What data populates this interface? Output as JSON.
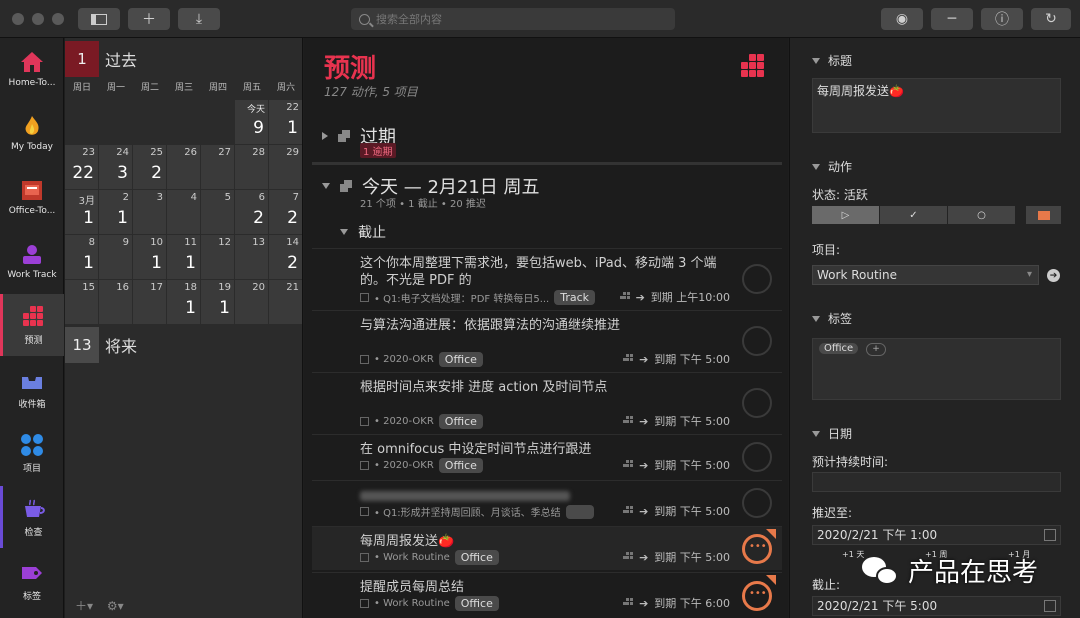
{
  "toolbar": {
    "search_placeholder": "搜索全部内容"
  },
  "sidebar": {
    "items": [
      {
        "label": "Home-To..."
      },
      {
        "label": "My Today"
      },
      {
        "label": "Office-To..."
      },
      {
        "label": "Work Track"
      },
      {
        "label": "预测"
      },
      {
        "label": "收件箱"
      },
      {
        "label": "项目"
      },
      {
        "label": "检查"
      },
      {
        "label": "标签"
      }
    ]
  },
  "calendar": {
    "past": {
      "count": "1",
      "label": "过去"
    },
    "future": {
      "count": "13",
      "label": "将来"
    },
    "weekdays": [
      "周日",
      "周一",
      "周二",
      "周三",
      "周四",
      "周五",
      "周六"
    ],
    "today_label": "今天",
    "weeks": [
      [
        {
          "d": "",
          "c": ""
        },
        {
          "d": "",
          "c": ""
        },
        {
          "d": "",
          "c": ""
        },
        {
          "d": "",
          "c": ""
        },
        {
          "d": "",
          "c": ""
        },
        {
          "d": "",
          "c": "9"
        },
        {
          "d": "22",
          "c": "1"
        }
      ],
      [
        {
          "d": "23",
          "c": "22"
        },
        {
          "d": "24",
          "c": "3"
        },
        {
          "d": "25",
          "c": "2"
        },
        {
          "d": "26",
          "c": ""
        },
        {
          "d": "27",
          "c": ""
        },
        {
          "d": "28",
          "c": ""
        },
        {
          "d": "29",
          "c": ""
        }
      ],
      [
        {
          "d": "3月",
          "c": "1"
        },
        {
          "d": "2",
          "c": "1"
        },
        {
          "d": "3",
          "c": ""
        },
        {
          "d": "4",
          "c": ""
        },
        {
          "d": "5",
          "c": ""
        },
        {
          "d": "6",
          "c": "2"
        },
        {
          "d": "7",
          "c": "2"
        }
      ],
      [
        {
          "d": "8",
          "c": "1"
        },
        {
          "d": "9",
          "c": ""
        },
        {
          "d": "10",
          "c": "1"
        },
        {
          "d": "11",
          "c": "1"
        },
        {
          "d": "12",
          "c": ""
        },
        {
          "d": "13",
          "c": ""
        },
        {
          "d": "14",
          "c": "2"
        }
      ],
      [
        {
          "d": "15",
          "c": ""
        },
        {
          "d": "16",
          "c": ""
        },
        {
          "d": "17",
          "c": ""
        },
        {
          "d": "18",
          "c": "1"
        },
        {
          "d": "19",
          "c": "1"
        },
        {
          "d": "20",
          "c": ""
        },
        {
          "d": "21",
          "c": ""
        }
      ]
    ]
  },
  "main": {
    "title": "预测",
    "subtitle": "127 动作, 5 项目",
    "overdue": {
      "title": "过期",
      "badge": "1 逾期"
    },
    "today": {
      "title": "今天 — 2月21日 周五",
      "meta": "21 个项 • 1 截止 • 20 推迟"
    },
    "due_section": "截止",
    "tasks": [
      {
        "title": "这个你本周整理下需求池，要包括web、iPad、移动端 3 个端的。不光是 PDF 的",
        "project": "• Q1:电子文档处理：PDF 转换每日5...",
        "tag": "Track",
        "due": "到期 上午10:00"
      },
      {
        "title": "与算法沟通进展：依据跟算法的沟通继续推进",
        "project": "• 2020-OKR",
        "tag": "Office",
        "due": "到期 下午 5:00"
      },
      {
        "title": "根据时间点来安排 进度 action 及时间节点",
        "project": "• 2020-OKR",
        "tag": "Office",
        "due": "到期 下午 5:00"
      },
      {
        "title": "在 omnifocus 中设定时间节点进行跟进",
        "project": "• 2020-OKR",
        "tag": "Office",
        "due": "到期 下午 5:00"
      },
      {
        "title": "",
        "project": "• Q1:形成并坚持周回顾、月谈话、季总结",
        "tag": "",
        "due": "到期 下午 5:00"
      },
      {
        "title": "每周周报发送🍅",
        "project": "• Work Routine",
        "tag": "Office",
        "due": "到期 下午 5:00"
      },
      {
        "title": "提醒成员每周总结",
        "project": "• Work Routine",
        "tag": "Office",
        "due": "到期 下午 6:00"
      }
    ]
  },
  "inspector": {
    "title_section": "标题",
    "title_value": "每周周报发送🍅",
    "action_section": "动作",
    "status_label": "状态: 活跃",
    "segments": [
      "▷",
      "✓",
      "○"
    ],
    "project_label": "项目:",
    "project_value": "Work Routine",
    "tags_section": "标签",
    "tag_value": "Office",
    "tag_add": "+",
    "date_section": "日期",
    "duration_label": "预计持续时间:",
    "defer_label": "推迟至:",
    "defer_value": "2020/2/21 下午 1:00",
    "quick1": "+1 天",
    "quick2": "+1 周",
    "quick3": "+1 月",
    "due_label": "截止:",
    "due_value": "2020/2/21 下午 5:00"
  },
  "watermark": "产品在思考",
  "colors": {
    "accent": "#e8334f",
    "orange": "#e7794a",
    "tag_bg": "#4a4a4a"
  }
}
